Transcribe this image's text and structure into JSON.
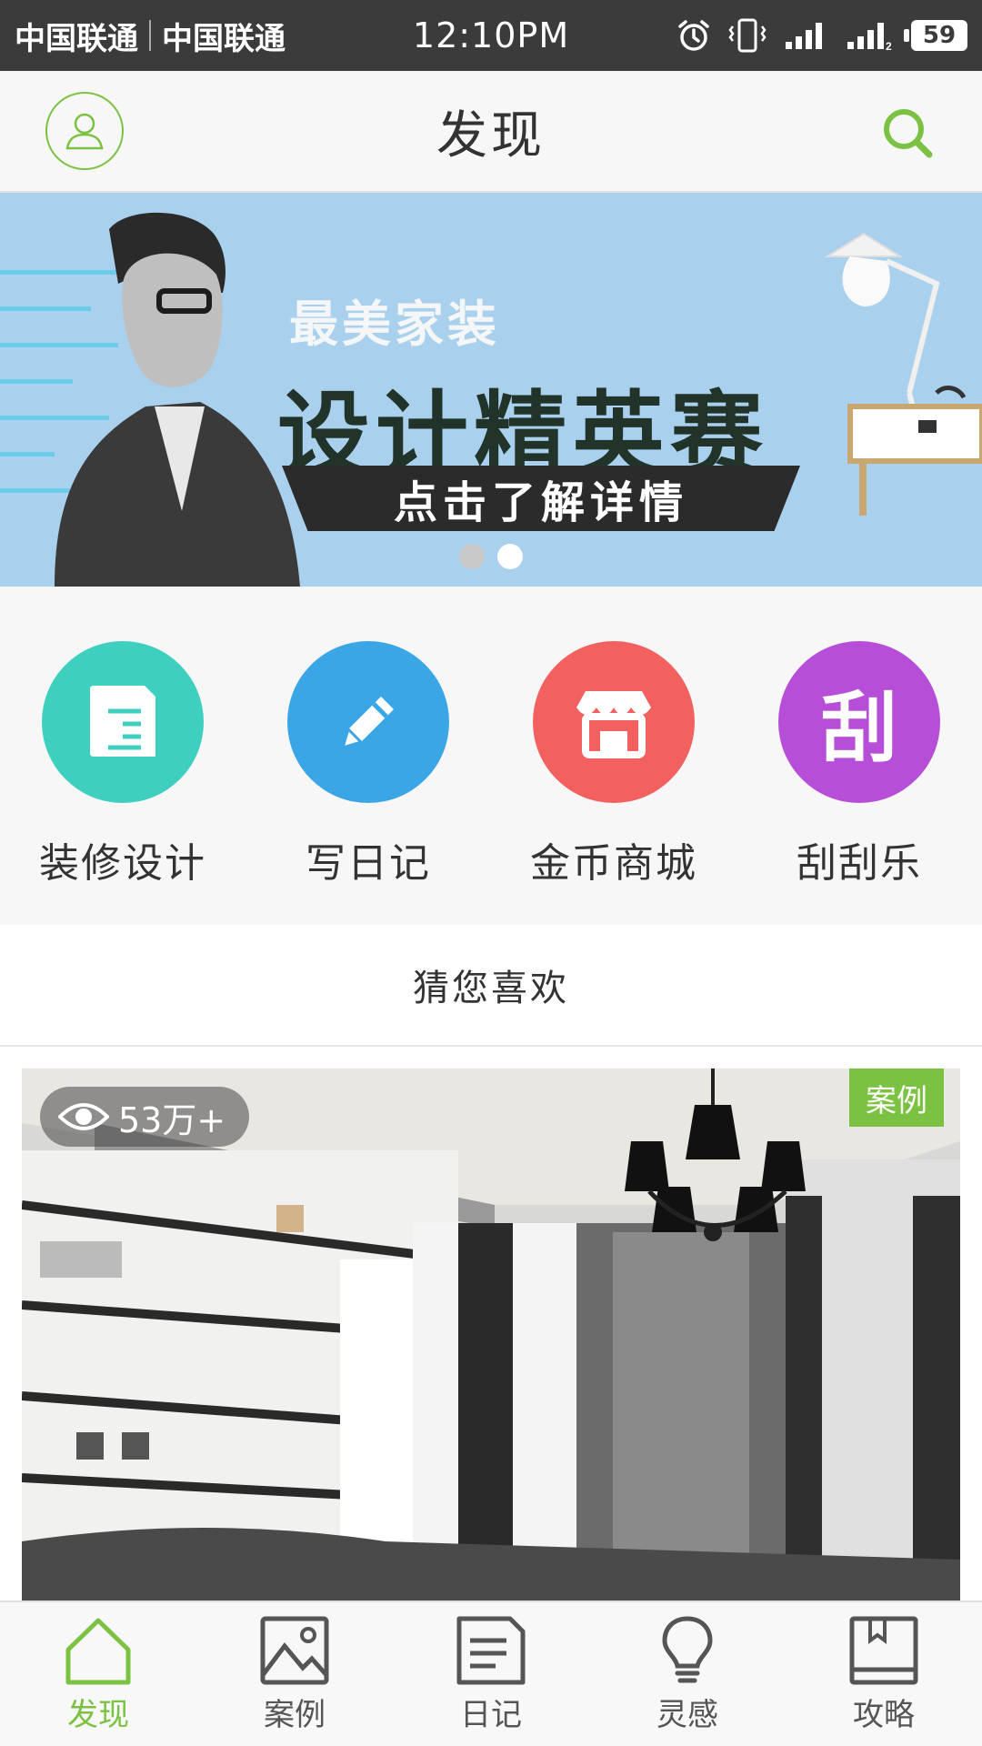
{
  "status_bar": {
    "carrier1": "中国联通",
    "carrier2": "中国联通",
    "time": "12:10PM",
    "battery": "59",
    "sim2_label": "2"
  },
  "header": {
    "title": "发现"
  },
  "banner": {
    "subtitle": "最美家装",
    "title": "设计精英赛",
    "cta": "点击了解详情",
    "active_dot": 2
  },
  "quick_actions": [
    {
      "label": "装修设计",
      "icon": "document-icon",
      "color": "#3fcfbf"
    },
    {
      "label": "写日记",
      "icon": "pencil-icon",
      "color": "#3aa6e6"
    },
    {
      "label": "金币商城",
      "icon": "store-icon",
      "color": "#f2605f"
    },
    {
      "label": "刮刮乐",
      "icon": "scratch-icon",
      "glyph": "刮",
      "color": "#b64ed8"
    }
  ],
  "recommend": {
    "title": "猜您喜欢",
    "card": {
      "views": "53万+",
      "tag": "案例"
    }
  },
  "tabs": [
    {
      "label": "发现",
      "icon": "home-icon",
      "active": true
    },
    {
      "label": "案例",
      "icon": "image-icon",
      "active": false
    },
    {
      "label": "日记",
      "icon": "note-icon",
      "active": false
    },
    {
      "label": "灵感",
      "icon": "bulb-icon",
      "active": false
    },
    {
      "label": "攻略",
      "icon": "book-icon",
      "active": false
    }
  ],
  "colors": {
    "accent": "#7cc242",
    "status_bar": "#3b3b3b",
    "banner_bg": "#a9d1ee"
  }
}
